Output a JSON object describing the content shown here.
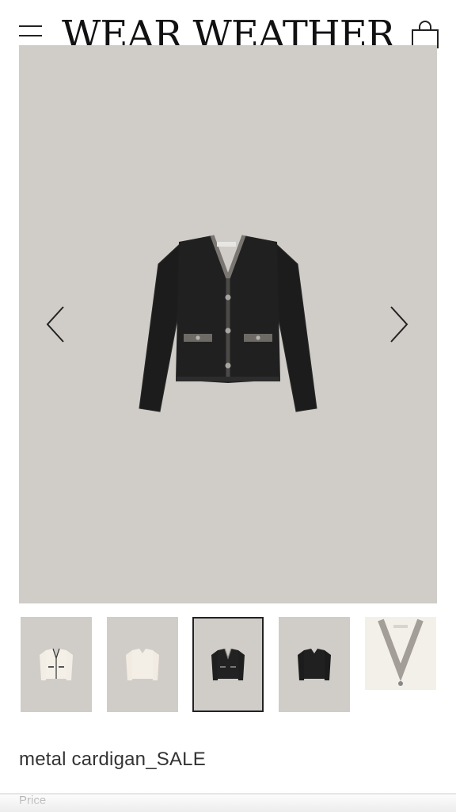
{
  "header": {
    "logo": "WEAR WEATHER",
    "menu_icon": "hamburger-menu-icon",
    "cart_icon": "shopping-bag-icon"
  },
  "gallery": {
    "prev_icon": "chevron-left-icon",
    "next_icon": "chevron-right-icon",
    "background_color": "#d0cdc9",
    "active_index": 2,
    "thumbnails": [
      {
        "variant": "ivory cardigan with black trim"
      },
      {
        "variant": "light beige cardigan"
      },
      {
        "variant": "black cardigan"
      },
      {
        "variant": "black cardigan"
      },
      {
        "variant": "ivory cardigan close-up"
      }
    ]
  },
  "product": {
    "name": "metal cardigan_SALE",
    "price_label": "Price"
  }
}
